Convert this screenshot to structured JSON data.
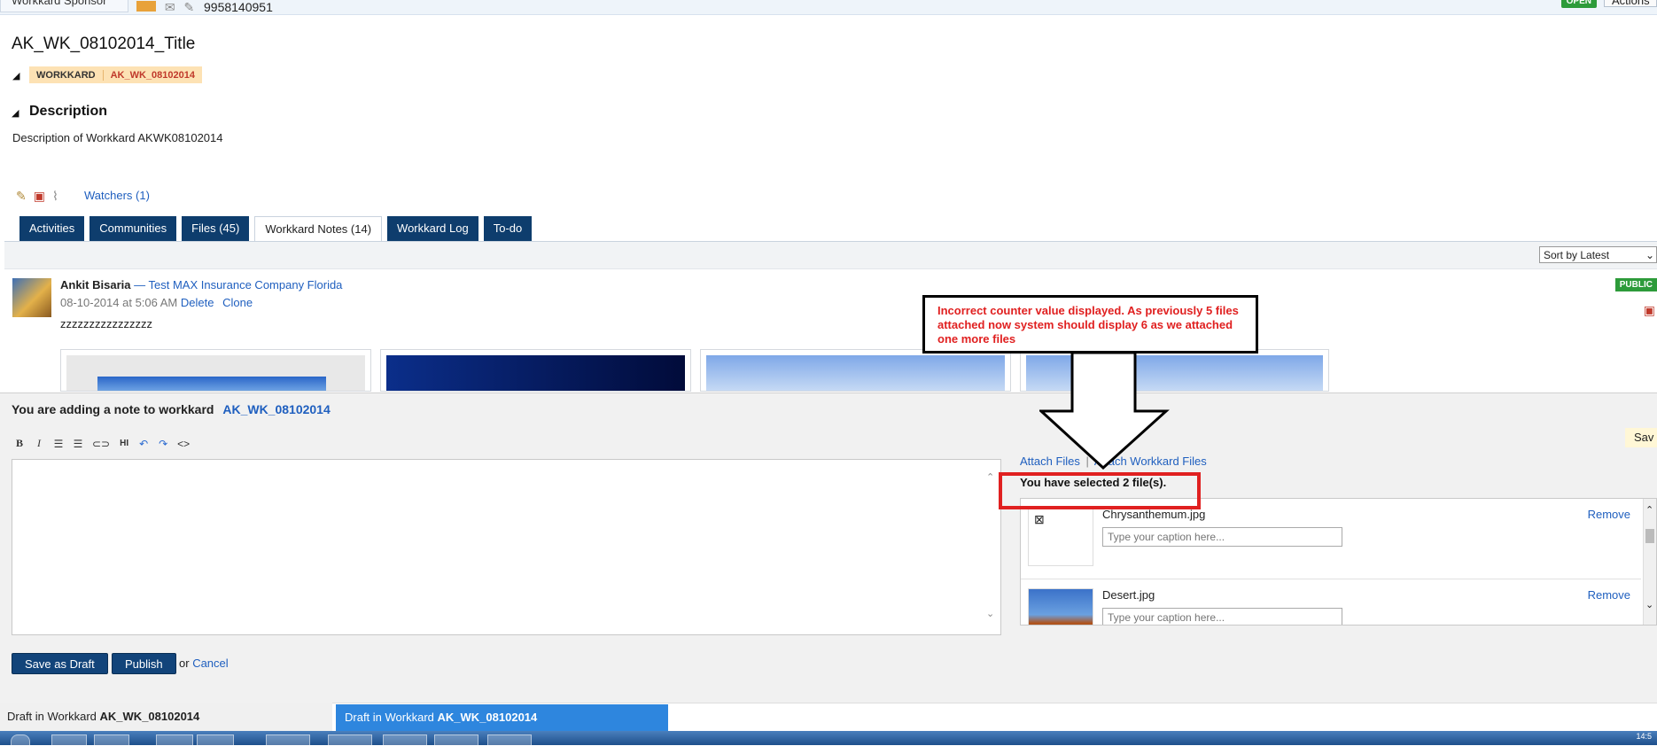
{
  "top": {
    "sponsor": "Workkard Sponsor",
    "phone": "9958140951",
    "status": "OPEN",
    "actions": "Actions"
  },
  "workkard": {
    "title": "AK_WK_08102014_Title",
    "badge_type": "WORKKARD",
    "badge_id": "AK_WK_08102014"
  },
  "description": {
    "heading": "Description",
    "text": "Description of Workkard AKWK08102014"
  },
  "watchers": "Watchers (1)",
  "tabs": {
    "activities": "Activities",
    "communities": "Communities",
    "files": "Files (45)",
    "notes": "Workkard Notes (14)",
    "log": "Workkard Log",
    "todo": "To-do"
  },
  "sort": "Sort by Latest",
  "note": {
    "author": "Ankit Bisaria",
    "company": "— Test MAX Insurance Company Florida",
    "date": "08-10-2014 at 5:06 AM",
    "delete": "Delete",
    "clone": "Clone",
    "text": "zzzzzzzzzzzzzzzz",
    "visibility": "PUBLIC"
  },
  "composer": {
    "adding_prefix": "You are adding a note to workkard",
    "adding_id": "AK_WK_08102014",
    "save_corner": "Sav",
    "attach_files": "Attach Files",
    "separator": "|",
    "attach_workkard_files": "Attach Workkard Files",
    "selected": "You have selected 2 file(s).",
    "files": [
      {
        "name": "Chrysanthemum.jpg",
        "caption_placeholder": "Type your caption here...",
        "remove": "Remove"
      },
      {
        "name": "Desert.jpg",
        "caption_placeholder": "Type your caption here...",
        "remove": "Remove"
      }
    ],
    "save_draft": "Save as Draft",
    "publish": "Publish",
    "or": "or",
    "cancel": "Cancel"
  },
  "bottom_tabs": {
    "tab1_prefix": "Draft in Workkard",
    "tab1_id": "AK_WK_08102014",
    "tab2_prefix": "Draft in Workkard",
    "tab2_id": "AK_WK_08102014"
  },
  "annotation": {
    "callout": "Incorrect counter value displayed. As previously 5 files attached now system should display 6 as we attached one more files"
  },
  "taskbar": {
    "clock": "14:5"
  },
  "colors": {
    "tab_bg": "#0e3d6d",
    "link": "#1f5fbf",
    "annotation_red": "#e02020",
    "status_green": "#2d9b3a"
  }
}
